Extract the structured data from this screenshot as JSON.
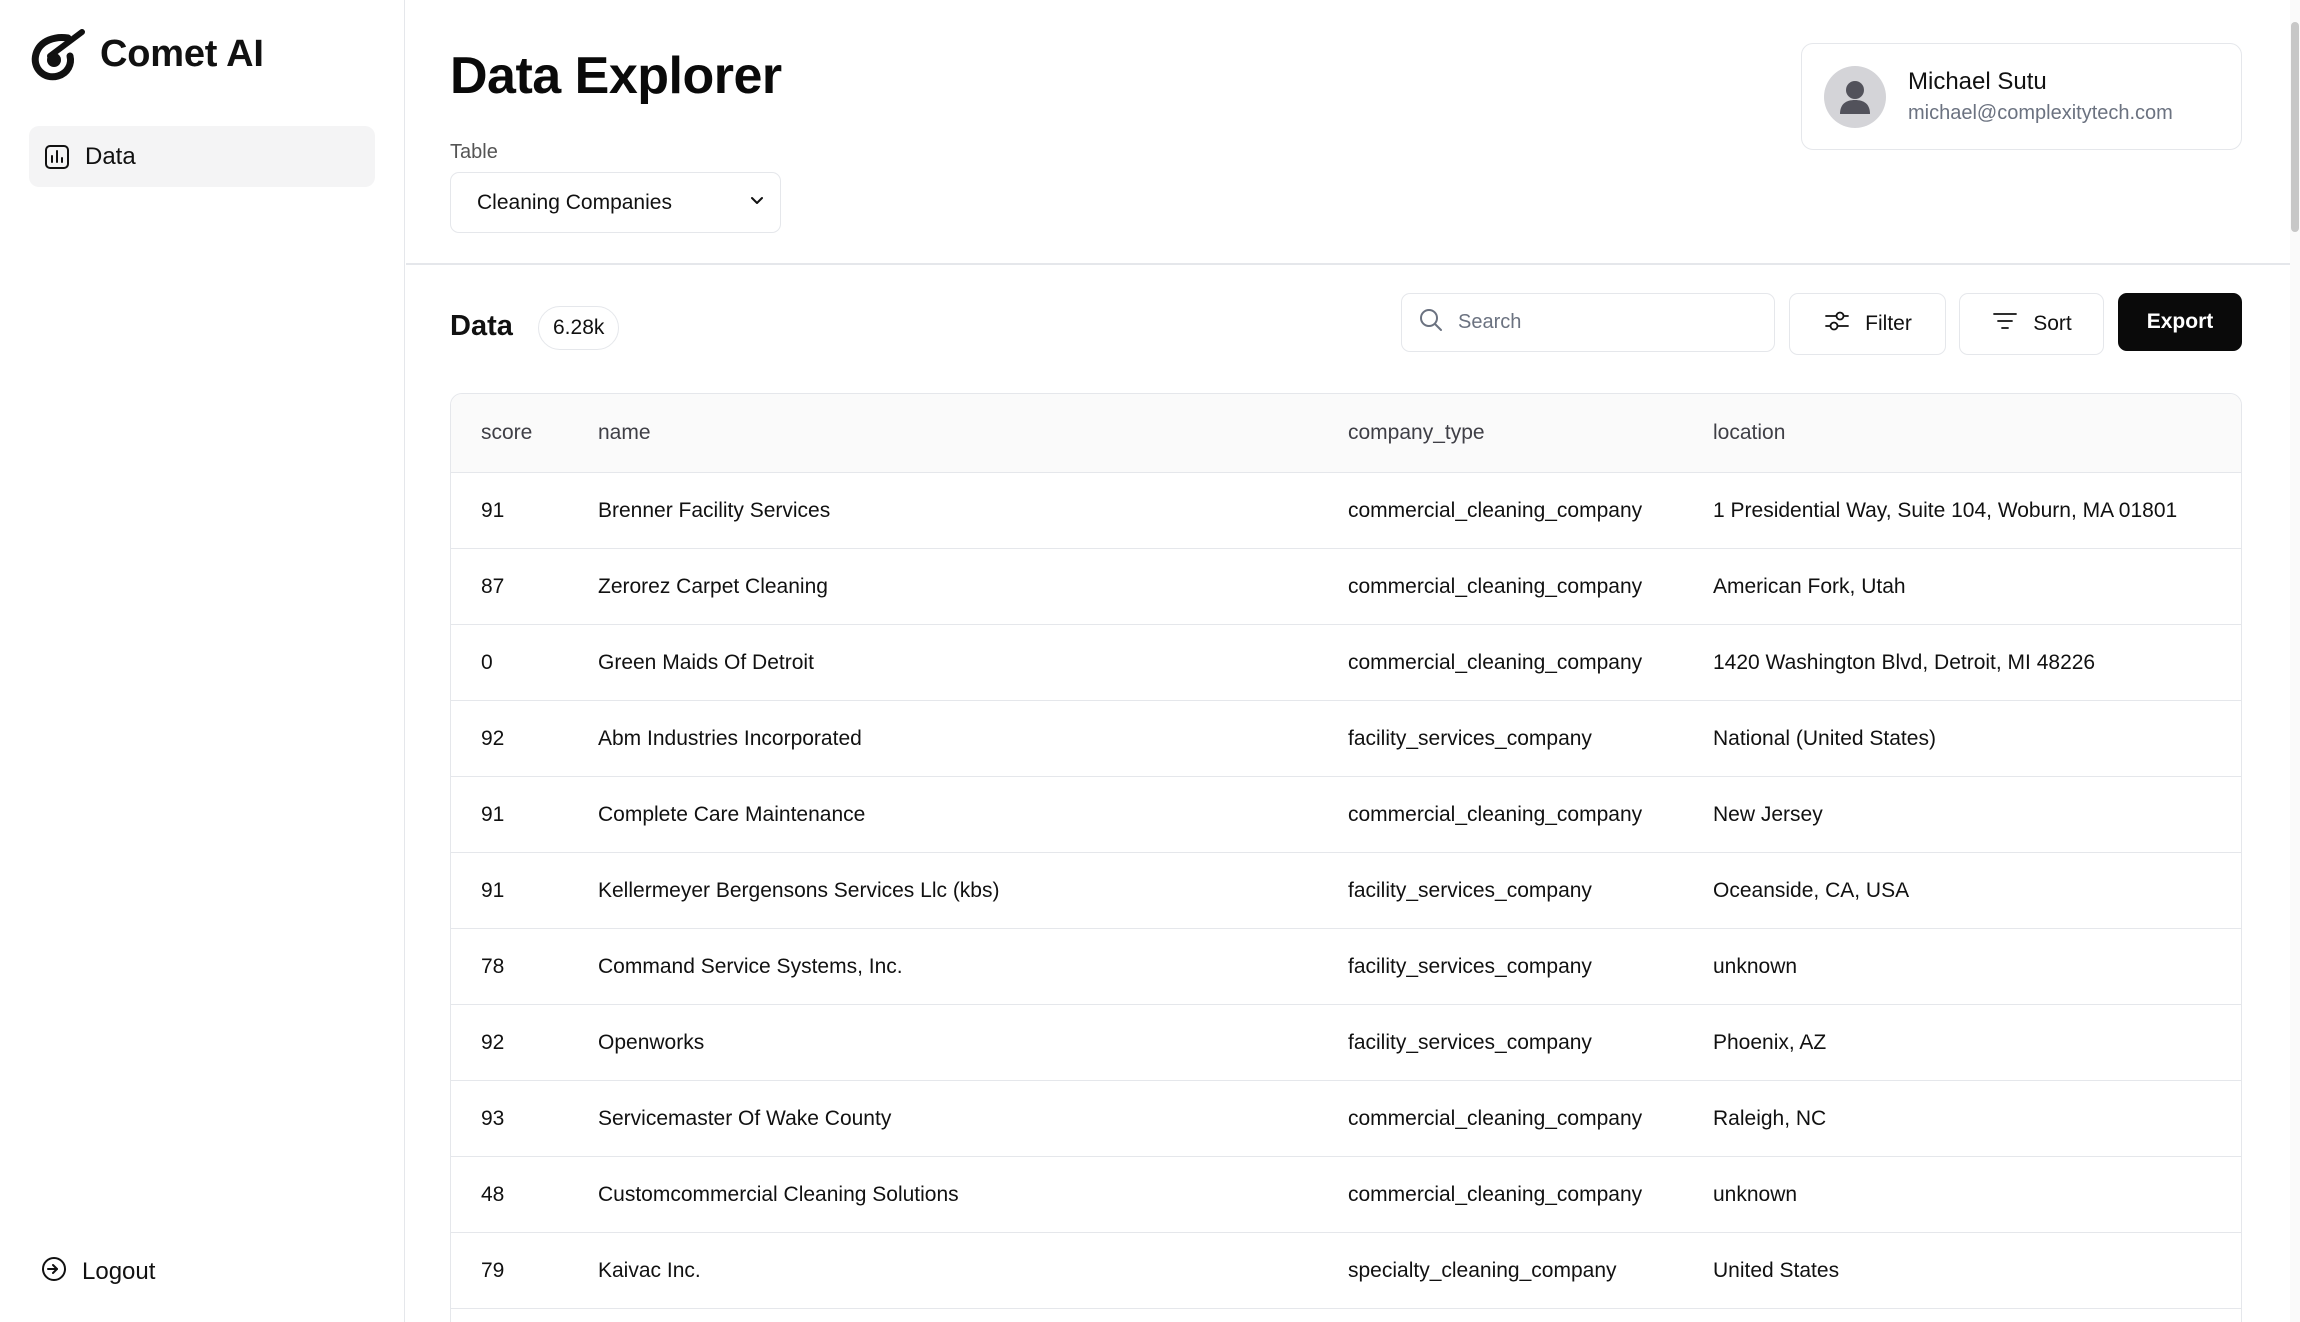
{
  "sidebar": {
    "brand": "Comet AI",
    "nav": [
      {
        "label": "Data",
        "icon": "bar-chart-icon"
      }
    ],
    "logout_label": "Logout"
  },
  "header": {
    "title": "Data Explorer",
    "table_label": "Table",
    "table_selected": "Cleaning Companies",
    "user": {
      "name": "Michael Sutu",
      "email": "michael@complexitytech.com"
    }
  },
  "toolbar": {
    "data_title": "Data",
    "count": "6.28k",
    "search_placeholder": "Search",
    "filter_label": "Filter",
    "sort_label": "Sort",
    "export_label": "Export"
  },
  "table": {
    "columns": [
      "score",
      "name",
      "company_type",
      "location"
    ],
    "rows": [
      [
        "91",
        "Brenner Facility Services",
        "commercial_cleaning_company",
        "1 Presidential Way, Suite 104, Woburn, MA 01801"
      ],
      [
        "87",
        "Zerorez Carpet Cleaning",
        "commercial_cleaning_company",
        "American Fork, Utah"
      ],
      [
        "0",
        "Green Maids Of Detroit",
        "commercial_cleaning_company",
        "1420 Washington Blvd, Detroit, MI 48226"
      ],
      [
        "92",
        "Abm Industries Incorporated",
        "facility_services_company",
        "National (United States)"
      ],
      [
        "91",
        "Complete Care Maintenance",
        "commercial_cleaning_company",
        "New Jersey"
      ],
      [
        "91",
        "Kellermeyer Bergensons Services Llc (kbs)",
        "facility_services_company",
        "Oceanside, CA, USA"
      ],
      [
        "78",
        "Command Service Systems, Inc.",
        "facility_services_company",
        "unknown"
      ],
      [
        "92",
        "Openworks",
        "facility_services_company",
        "Phoenix, AZ"
      ],
      [
        "93",
        "Servicemaster Of Wake County",
        "commercial_cleaning_company",
        "Raleigh, NC"
      ],
      [
        "48",
        "Customcommercial Cleaning Solutions",
        "commercial_cleaning_company",
        "unknown"
      ],
      [
        "79",
        "Kaivac Inc.",
        "specialty_cleaning_company",
        "United States"
      ]
    ]
  }
}
